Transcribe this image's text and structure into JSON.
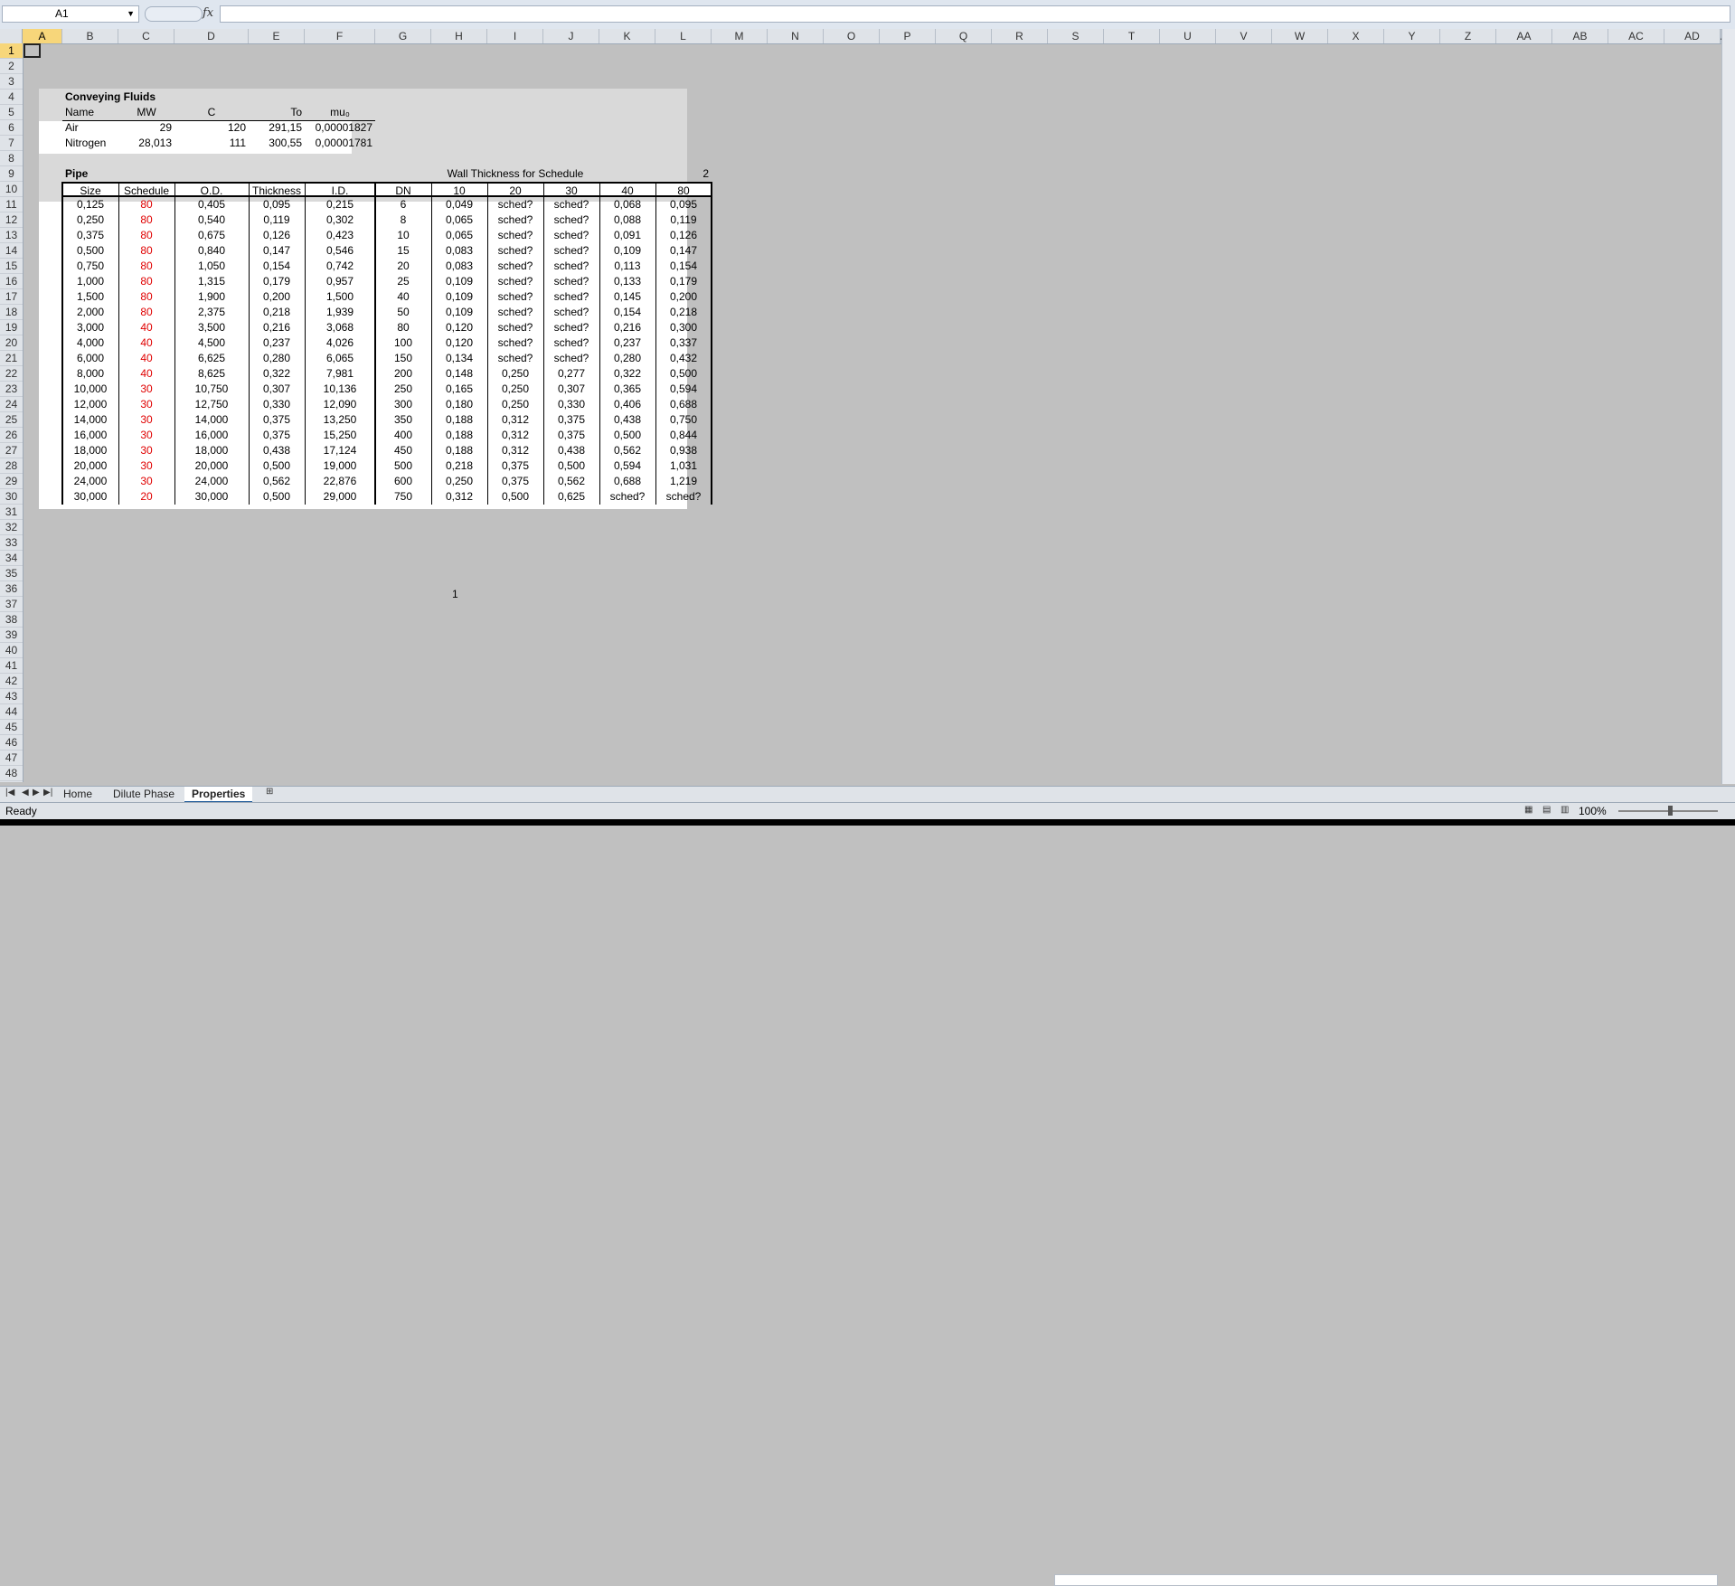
{
  "formula_bar": {
    "name_box": "A1",
    "fx": "fx",
    "formula": ""
  },
  "columns": [
    "A",
    "B",
    "C",
    "D",
    "E",
    "F",
    "G",
    "H",
    "I",
    "J",
    "K",
    "L",
    "M",
    "N",
    "O",
    "P",
    "Q",
    "R",
    "S",
    "T",
    "U",
    "V",
    "W",
    "X",
    "Y",
    "Z",
    "AA",
    "AB",
    "AC",
    "AD",
    "A"
  ],
  "rows": [
    "1",
    "2",
    "3",
    "4",
    "5",
    "6",
    "7",
    "8",
    "9",
    "10",
    "11",
    "12",
    "13",
    "14",
    "15",
    "16",
    "17",
    "18",
    "19",
    "20",
    "21",
    "22",
    "23",
    "24",
    "25",
    "26",
    "27",
    "28",
    "29",
    "30",
    "31",
    "32",
    "33",
    "34",
    "35",
    "36",
    "37",
    "38",
    "39",
    "40",
    "41",
    "42",
    "43",
    "44",
    "45",
    "46",
    "47",
    "48"
  ],
  "fluids": {
    "title": "Conveying Fluids",
    "headers": [
      "Name",
      "MW",
      "C",
      "To",
      "mu₀"
    ],
    "rows": [
      [
        "Air",
        "29",
        "120",
        "291,15",
        "0,00001827"
      ],
      [
        "Nitrogen",
        "28,013",
        "111",
        "300,55",
        "0,00001781"
      ]
    ]
  },
  "pipe": {
    "title": "Pipe",
    "wall_title": "Wall Thickness for Schedule",
    "wall_index": "2",
    "headers": [
      "Size",
      "Schedule",
      "O.D.",
      "Thickness",
      "I.D.",
      "DN",
      "10",
      "20",
      "30",
      "40",
      "80"
    ],
    "rows": [
      [
        "0,125",
        "80",
        "0,405",
        "0,095",
        "0,215",
        "6",
        "0,049",
        "sched?",
        "sched?",
        "0,068",
        "0,095"
      ],
      [
        "0,250",
        "80",
        "0,540",
        "0,119",
        "0,302",
        "8",
        "0,065",
        "sched?",
        "sched?",
        "0,088",
        "0,119"
      ],
      [
        "0,375",
        "80",
        "0,675",
        "0,126",
        "0,423",
        "10",
        "0,065",
        "sched?",
        "sched?",
        "0,091",
        "0,126"
      ],
      [
        "0,500",
        "80",
        "0,840",
        "0,147",
        "0,546",
        "15",
        "0,083",
        "sched?",
        "sched?",
        "0,109",
        "0,147"
      ],
      [
        "0,750",
        "80",
        "1,050",
        "0,154",
        "0,742",
        "20",
        "0,083",
        "sched?",
        "sched?",
        "0,113",
        "0,154"
      ],
      [
        "1,000",
        "80",
        "1,315",
        "0,179",
        "0,957",
        "25",
        "0,109",
        "sched?",
        "sched?",
        "0,133",
        "0,179"
      ],
      [
        "1,500",
        "80",
        "1,900",
        "0,200",
        "1,500",
        "40",
        "0,109",
        "sched?",
        "sched?",
        "0,145",
        "0,200"
      ],
      [
        "2,000",
        "80",
        "2,375",
        "0,218",
        "1,939",
        "50",
        "0,109",
        "sched?",
        "sched?",
        "0,154",
        "0,218"
      ],
      [
        "3,000",
        "40",
        "3,500",
        "0,216",
        "3,068",
        "80",
        "0,120",
        "sched?",
        "sched?",
        "0,216",
        "0,300"
      ],
      [
        "4,000",
        "40",
        "4,500",
        "0,237",
        "4,026",
        "100",
        "0,120",
        "sched?",
        "sched?",
        "0,237",
        "0,337"
      ],
      [
        "6,000",
        "40",
        "6,625",
        "0,280",
        "6,065",
        "150",
        "0,134",
        "sched?",
        "sched?",
        "0,280",
        "0,432"
      ],
      [
        "8,000",
        "40",
        "8,625",
        "0,322",
        "7,981",
        "200",
        "0,148",
        "0,250",
        "0,277",
        "0,322",
        "0,500"
      ],
      [
        "10,000",
        "30",
        "10,750",
        "0,307",
        "10,136",
        "250",
        "0,165",
        "0,250",
        "0,307",
        "0,365",
        "0,594"
      ],
      [
        "12,000",
        "30",
        "12,750",
        "0,330",
        "12,090",
        "300",
        "0,180",
        "0,250",
        "0,330",
        "0,406",
        "0,688"
      ],
      [
        "14,000",
        "30",
        "14,000",
        "0,375",
        "13,250",
        "350",
        "0,188",
        "0,312",
        "0,375",
        "0,438",
        "0,750"
      ],
      [
        "16,000",
        "30",
        "16,000",
        "0,375",
        "15,250",
        "400",
        "0,188",
        "0,312",
        "0,375",
        "0,500",
        "0,844"
      ],
      [
        "18,000",
        "30",
        "18,000",
        "0,438",
        "17,124",
        "450",
        "0,188",
        "0,312",
        "0,438",
        "0,562",
        "0,938"
      ],
      [
        "20,000",
        "30",
        "20,000",
        "0,500",
        "19,000",
        "500",
        "0,218",
        "0,375",
        "0,500",
        "0,594",
        "1,031"
      ],
      [
        "24,000",
        "30",
        "24,000",
        "0,562",
        "22,876",
        "600",
        "0,250",
        "0,375",
        "0,562",
        "0,688",
        "1,219"
      ],
      [
        "30,000",
        "20",
        "30,000",
        "0,500",
        "29,000",
        "750",
        "0,312",
        "0,500",
        "0,625",
        "sched?",
        "sched?"
      ]
    ]
  },
  "page_label": "1",
  "sheet_tabs": [
    "Home",
    "Dilute Phase",
    "Properties"
  ],
  "active_tab": "Properties",
  "status": {
    "text": "Ready",
    "zoom": "100%"
  }
}
